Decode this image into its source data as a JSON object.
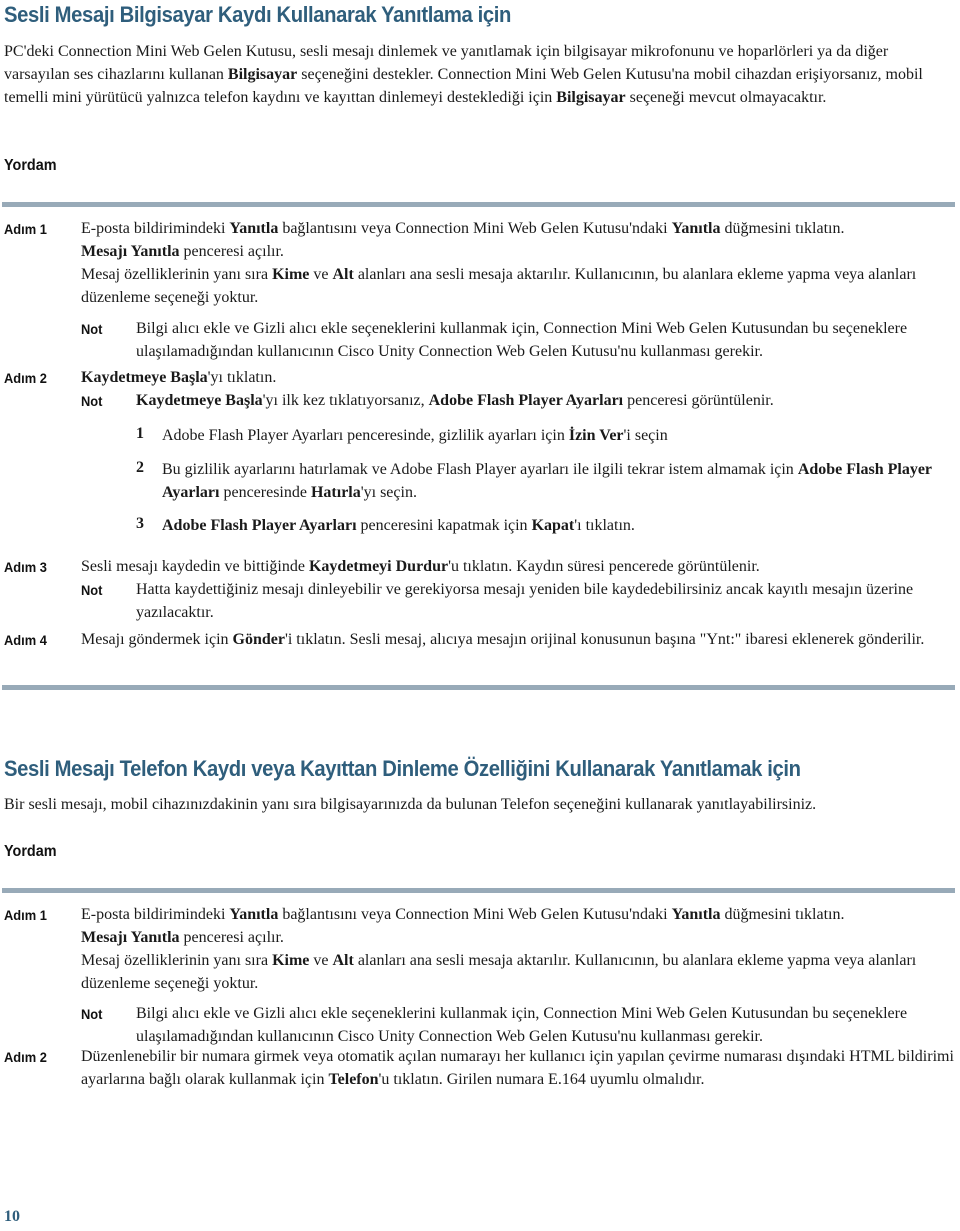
{
  "section1": {
    "title": "Sesli Mesajı Bilgisayar Kaydı Kullanarak Yanıtlama için",
    "intro": [
      {
        "t": "PC'deki Connection Mini Web Gelen Kutusu, sesli mesajı dinlemek ve yanıtlamak için bilgisayar mikrofonunu ve hoparlörleri ya da diğer varsayılan ses cihazlarını kullanan "
      },
      {
        "t": "Bilgisayar",
        "b": true
      },
      {
        "t": " seçeneğini destekler. Connection Mini Web Gelen Kutusu'na mobil cihazdan erişiyorsanız, mobil temelli mini yürütücü yalnızca telefon kaydını ve kayıttan dinlemeyi desteklediği için "
      },
      {
        "t": "Bilgisayar",
        "b": true
      },
      {
        "t": " seçeneği mevcut olmayacaktır."
      }
    ],
    "procedure_label": "Yordam",
    "steps": {
      "step1": {
        "label": "Adım 1",
        "line1": [
          {
            "t": "E-posta bildirimindeki "
          },
          {
            "t": "Yanıtla",
            "b": true
          },
          {
            "t": " bağlantısını veya Connection Mini Web Gelen Kutusu'ndaki "
          },
          {
            "t": "Yanıtla",
            "b": true
          },
          {
            "t": " düğmesini tıklatın."
          }
        ],
        "line2": [
          {
            "t": "Mesajı Yanıtla",
            "b": true
          },
          {
            "t": " penceresi açılır."
          }
        ],
        "line3": [
          {
            "t": "Mesaj özelliklerinin yanı sıra "
          },
          {
            "t": "Kime",
            "b": true
          },
          {
            "t": " ve "
          },
          {
            "t": "Alt",
            "b": true
          },
          {
            "t": " alanları ana sesli mesaja aktarılır. Kullanıcının, bu alanlara ekleme yapma veya alanları düzenleme seçeneği yoktur."
          }
        ],
        "note_label": "Not",
        "note": [
          {
            "t": "Bilgi alıcı ekle ve Gizli alıcı ekle seçeneklerini kullanmak için, Connection Mini Web Gelen Kutusundan bu seçeneklere ulaşılamadığından kullanıcının Cisco Unity Connection Web Gelen Kutusu'nu kullanması gerekir."
          }
        ]
      },
      "step2": {
        "label": "Adım 2",
        "line1": [
          {
            "t": "Kaydetmeye Başla",
            "b": true
          },
          {
            "t": "'yı tıklatın."
          }
        ],
        "note_label": "Not",
        "note": [
          {
            "t": "Kaydetmeye Başla",
            "b": true
          },
          {
            "t": "'yı ilk kez tıklatıyorsanız, "
          },
          {
            "t": "Adobe Flash Player Ayarları",
            "b": true
          },
          {
            "t": " penceresi görüntülenir."
          }
        ],
        "substeps": [
          {
            "num": "1",
            "text": [
              {
                "t": "Adobe Flash Player Ayarları penceresinde, gizlilik ayarları için "
              },
              {
                "t": "İzin Ver",
                "b": true
              },
              {
                "t": "'i seçin"
              }
            ]
          },
          {
            "num": "2",
            "text": [
              {
                "t": "Bu gizlilik ayarlarını hatırlamak ve Adobe Flash Player ayarları ile ilgili tekrar istem almamak için "
              },
              {
                "t": "Adobe Flash Player Ayarları",
                "b": true
              },
              {
                "t": " penceresinde "
              },
              {
                "t": "Hatırla",
                "b": true
              },
              {
                "t": "'yı seçin."
              }
            ]
          },
          {
            "num": "3",
            "text": [
              {
                "t": "Adobe Flash Player Ayarları",
                "b": true
              },
              {
                "t": " penceresini kapatmak için "
              },
              {
                "t": "Kapat",
                "b": true
              },
              {
                "t": "'ı tıklatın."
              }
            ]
          }
        ]
      },
      "step3": {
        "label": "Adım 3",
        "line1": [
          {
            "t": "Sesli mesajı kaydedin ve bittiğinde "
          },
          {
            "t": "Kaydetmeyi Durdur",
            "b": true
          },
          {
            "t": "'u tıklatın. Kaydın süresi pencerede görüntülenir."
          }
        ],
        "note_label": "Not",
        "note": [
          {
            "t": "Hatta kaydettiğiniz mesajı dinleyebilir ve gerekiyorsa mesajı yeniden bile kaydedebilirsiniz ancak kayıtlı mesajın üzerine yazılacaktır."
          }
        ]
      },
      "step4": {
        "label": "Adım 4",
        "line1": [
          {
            "t": "Mesajı göndermek için "
          },
          {
            "t": "Gönder",
            "b": true
          },
          {
            "t": "'i tıklatın. Sesli mesaj, alıcıya mesajın orijinal konusunun başına \"Ynt:\" ibaresi eklenerek gönderilir."
          }
        ]
      }
    }
  },
  "section2": {
    "title": "Sesli Mesajı Telefon Kaydı veya Kayıttan Dinleme Özelliğini Kullanarak Yanıtlamak için",
    "intro": [
      {
        "t": "Bir sesli mesajı, mobil cihazınızdakinin yanı sıra bilgisayarınızda da bulunan Telefon seçeneğini kullanarak yanıtlayabilirsiniz."
      }
    ],
    "procedure_label": "Yordam",
    "steps": {
      "step1": {
        "label": "Adım 1",
        "line1": [
          {
            "t": "E-posta bildirimindeki "
          },
          {
            "t": "Yanıtla",
            "b": true
          },
          {
            "t": " bağlantısını veya Connection Mini Web Gelen Kutusu'ndaki "
          },
          {
            "t": "Yanıtla",
            "b": true
          },
          {
            "t": " düğmesini tıklatın."
          }
        ],
        "line2": [
          {
            "t": "Mesajı Yanıtla",
            "b": true
          },
          {
            "t": " penceresi açılır."
          }
        ],
        "line3": [
          {
            "t": "Mesaj özelliklerinin yanı sıra "
          },
          {
            "t": "Kime",
            "b": true
          },
          {
            "t": " ve "
          },
          {
            "t": "Alt",
            "b": true
          },
          {
            "t": " alanları ana sesli mesaja aktarılır. Kullanıcının, bu alanlara ekleme yapma veya alanları düzenleme seçeneği yoktur."
          }
        ],
        "note_label": "Not",
        "note": [
          {
            "t": "Bilgi alıcı ekle ve Gizli alıcı ekle seçeneklerini kullanmak için, Connection Mini Web Gelen Kutusundan bu seçeneklere ulaşılamadığından kullanıcının Cisco Unity Connection Web Gelen Kutusu'nu kullanması gerekir."
          }
        ]
      },
      "step2": {
        "label": "Adım 2",
        "line1": [
          {
            "t": "Düzenlenebilir bir numara girmek veya otomatik açılan numarayı her kullanıcı için yapılan çevirme numarası dışındaki HTML bildirimi ayarlarına bağlı olarak kullanmak için "
          },
          {
            "t": "Telefon",
            "b": true
          },
          {
            "t": "'u tıklatın. Girilen numara E.164 uyumlu olmalıdır."
          }
        ]
      }
    }
  },
  "footer": {
    "page_number": "10"
  },
  "colors": {
    "heading": "#2f5e7c",
    "rule": "#98aab8",
    "text": "#1a1a1a"
  }
}
